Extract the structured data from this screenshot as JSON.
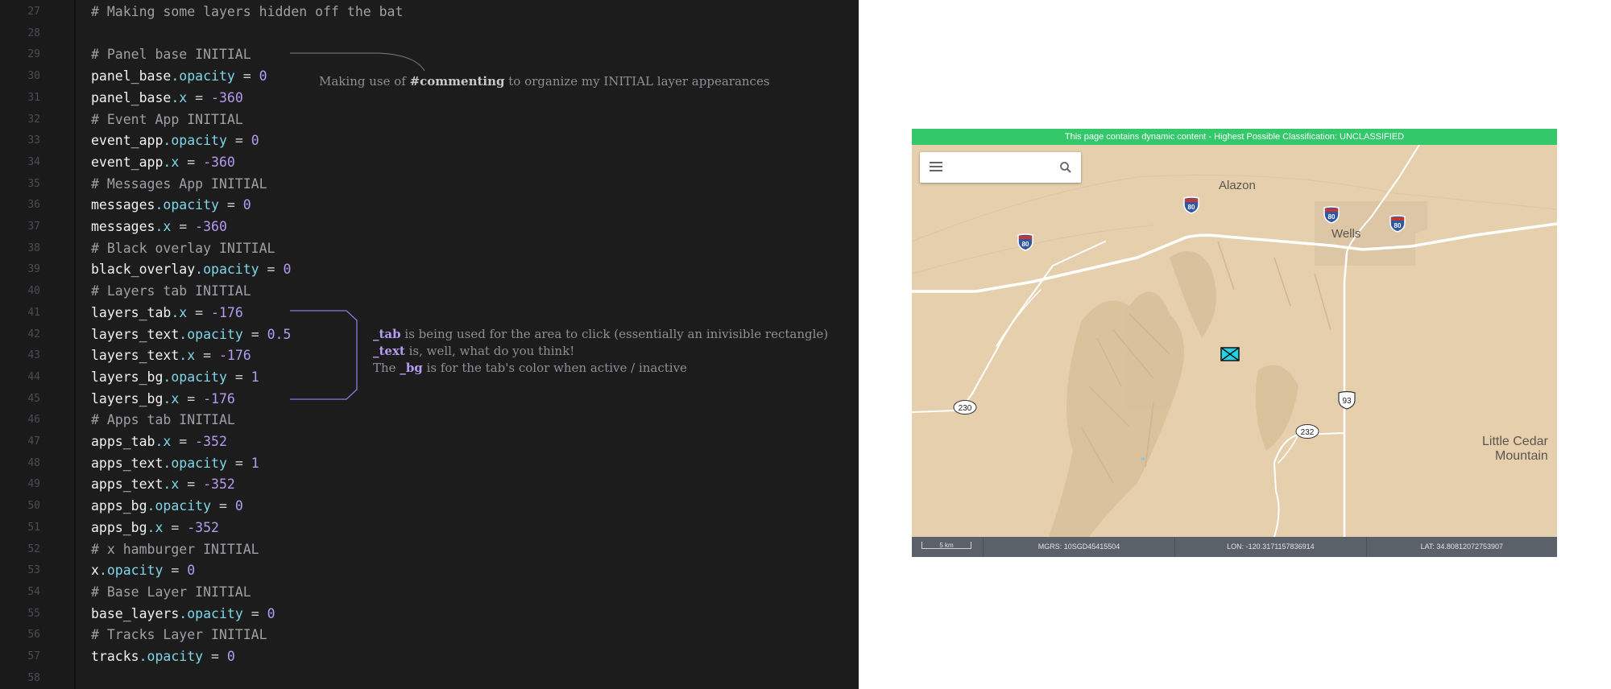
{
  "editor": {
    "lines": [
      {
        "n": "27",
        "tokens": [
          {
            "t": "# Making some layers hidden off the bat",
            "c": "comment"
          }
        ]
      },
      {
        "n": "28",
        "tokens": []
      },
      {
        "n": "29",
        "tokens": [
          {
            "t": "# Panel base INITIAL",
            "c": "comment"
          }
        ]
      },
      {
        "n": "30",
        "tokens": [
          {
            "t": "panel_base",
            "c": "var"
          },
          {
            "t": ".opacity",
            "c": "prop"
          },
          {
            "t": " = ",
            "c": "op"
          },
          {
            "t": "0",
            "c": "num"
          }
        ]
      },
      {
        "n": "31",
        "tokens": [
          {
            "t": "panel_base",
            "c": "var"
          },
          {
            "t": ".x",
            "c": "prop"
          },
          {
            "t": " = ",
            "c": "op"
          },
          {
            "t": "-360",
            "c": "num"
          }
        ]
      },
      {
        "n": "32",
        "tokens": [
          {
            "t": "# Event App INITIAL",
            "c": "comment"
          }
        ]
      },
      {
        "n": "33",
        "tokens": [
          {
            "t": "event_app",
            "c": "var"
          },
          {
            "t": ".opacity",
            "c": "prop"
          },
          {
            "t": " = ",
            "c": "op"
          },
          {
            "t": "0",
            "c": "num"
          }
        ]
      },
      {
        "n": "34",
        "tokens": [
          {
            "t": "event_app",
            "c": "var"
          },
          {
            "t": ".x",
            "c": "prop"
          },
          {
            "t": " = ",
            "c": "op"
          },
          {
            "t": "-360",
            "c": "num"
          }
        ]
      },
      {
        "n": "35",
        "tokens": [
          {
            "t": "# Messages App INITIAL",
            "c": "comment"
          }
        ]
      },
      {
        "n": "36",
        "tokens": [
          {
            "t": "messages",
            "c": "var"
          },
          {
            "t": ".opacity",
            "c": "prop"
          },
          {
            "t": " = ",
            "c": "op"
          },
          {
            "t": "0",
            "c": "num"
          }
        ]
      },
      {
        "n": "37",
        "tokens": [
          {
            "t": "messages",
            "c": "var"
          },
          {
            "t": ".x",
            "c": "prop"
          },
          {
            "t": " = ",
            "c": "op"
          },
          {
            "t": "-360",
            "c": "num"
          }
        ]
      },
      {
        "n": "38",
        "tokens": [
          {
            "t": "# Black overlay INITIAL",
            "c": "comment"
          }
        ]
      },
      {
        "n": "39",
        "tokens": [
          {
            "t": "black_overlay",
            "c": "var"
          },
          {
            "t": ".opacity",
            "c": "prop"
          },
          {
            "t": " = ",
            "c": "op"
          },
          {
            "t": "0",
            "c": "num"
          }
        ]
      },
      {
        "n": "40",
        "tokens": [
          {
            "t": "# Layers tab INITIAL",
            "c": "comment"
          }
        ]
      },
      {
        "n": "41",
        "tokens": [
          {
            "t": "layers_tab",
            "c": "var"
          },
          {
            "t": ".x",
            "c": "prop"
          },
          {
            "t": " = ",
            "c": "op"
          },
          {
            "t": "-176",
            "c": "num"
          }
        ]
      },
      {
        "n": "42",
        "tokens": [
          {
            "t": "layers_text",
            "c": "var"
          },
          {
            "t": ".opacity",
            "c": "prop"
          },
          {
            "t": " = ",
            "c": "op"
          },
          {
            "t": "0.5",
            "c": "num"
          }
        ]
      },
      {
        "n": "43",
        "tokens": [
          {
            "t": "layers_text",
            "c": "var"
          },
          {
            "t": ".x",
            "c": "prop"
          },
          {
            "t": " = ",
            "c": "op"
          },
          {
            "t": "-176",
            "c": "num"
          }
        ]
      },
      {
        "n": "44",
        "tokens": [
          {
            "t": "layers_bg",
            "c": "var"
          },
          {
            "t": ".opacity",
            "c": "prop"
          },
          {
            "t": " = ",
            "c": "op"
          },
          {
            "t": "1",
            "c": "num"
          }
        ]
      },
      {
        "n": "45",
        "tokens": [
          {
            "t": "layers_bg",
            "c": "var"
          },
          {
            "t": ".x",
            "c": "prop"
          },
          {
            "t": " = ",
            "c": "op"
          },
          {
            "t": "-176",
            "c": "num"
          }
        ]
      },
      {
        "n": "46",
        "tokens": [
          {
            "t": "# Apps tab INITIAL",
            "c": "comment"
          }
        ]
      },
      {
        "n": "47",
        "tokens": [
          {
            "t": "apps_tab",
            "c": "var"
          },
          {
            "t": ".x",
            "c": "prop"
          },
          {
            "t": " = ",
            "c": "op"
          },
          {
            "t": "-352",
            "c": "num"
          }
        ]
      },
      {
        "n": "48",
        "tokens": [
          {
            "t": "apps_text",
            "c": "var"
          },
          {
            "t": ".opacity",
            "c": "prop"
          },
          {
            "t": " = ",
            "c": "op"
          },
          {
            "t": "1",
            "c": "num"
          }
        ]
      },
      {
        "n": "49",
        "tokens": [
          {
            "t": "apps_text",
            "c": "var"
          },
          {
            "t": ".x",
            "c": "prop"
          },
          {
            "t": " = ",
            "c": "op"
          },
          {
            "t": "-352",
            "c": "num"
          }
        ]
      },
      {
        "n": "50",
        "tokens": [
          {
            "t": "apps_bg",
            "c": "var"
          },
          {
            "t": ".opacity",
            "c": "prop"
          },
          {
            "t": " = ",
            "c": "op"
          },
          {
            "t": "0",
            "c": "num"
          }
        ]
      },
      {
        "n": "51",
        "tokens": [
          {
            "t": "apps_bg",
            "c": "var"
          },
          {
            "t": ".x",
            "c": "prop"
          },
          {
            "t": " = ",
            "c": "op"
          },
          {
            "t": "-352",
            "c": "num"
          }
        ]
      },
      {
        "n": "52",
        "tokens": [
          {
            "t": "# x hamburger INITIAL",
            "c": "comment"
          }
        ]
      },
      {
        "n": "53",
        "tokens": [
          {
            "t": "x",
            "c": "var"
          },
          {
            "t": ".opacity",
            "c": "prop"
          },
          {
            "t": " = ",
            "c": "op"
          },
          {
            "t": "0",
            "c": "num"
          }
        ]
      },
      {
        "n": "54",
        "tokens": [
          {
            "t": "# Base Layer INITIAL",
            "c": "comment"
          }
        ]
      },
      {
        "n": "55",
        "tokens": [
          {
            "t": "base_layers",
            "c": "var"
          },
          {
            "t": ".opacity",
            "c": "prop"
          },
          {
            "t": " = ",
            "c": "op"
          },
          {
            "t": "0",
            "c": "num"
          }
        ]
      },
      {
        "n": "56",
        "tokens": [
          {
            "t": "# Tracks Layer INITIAL",
            "c": "comment"
          }
        ]
      },
      {
        "n": "57",
        "tokens": [
          {
            "t": "tracks",
            "c": "var"
          },
          {
            "t": ".opacity",
            "c": "prop"
          },
          {
            "t": " = ",
            "c": "op"
          },
          {
            "t": "0",
            "c": "num"
          }
        ]
      },
      {
        "n": "58",
        "tokens": []
      }
    ]
  },
  "annotations": {
    "commenting": {
      "pre": "Making use of ",
      "bold": "#commenting",
      "post": " to organize my INITIAL layer appearances"
    },
    "layers_lines": [
      {
        "bold": "_tab",
        "text": " is being used for the area to click (essentially an inivisible rectangle)"
      },
      {
        "bold": "_text",
        "text": " is, well, what do you think!"
      },
      {
        "pre": "The ",
        "bold": "_bg",
        "text": " is for the tab's color when active / inactive"
      }
    ]
  },
  "map": {
    "banner": "This page contains dynamic content - Highest Possible Classification: UNCLASSIFIED",
    "places": {
      "alazon": "Alazon",
      "wells": "Wells",
      "little_cedar_1": "Little Cedar",
      "little_cedar_2": "Mountain"
    },
    "shields": {
      "i80": "80",
      "us93": "93",
      "r230": "230",
      "r232": "232"
    },
    "status": {
      "scale": "5 km",
      "mgrs": "MGRS: 10SGD45415504",
      "lon": "LON: -120.3171157836914",
      "lat": "LAT: 34.80812072753907"
    },
    "colors": {
      "banner": "#33c96b",
      "terrain": "#e6cfad",
      "marker": "#22d3e6",
      "statusbar": "#5a6168"
    }
  }
}
